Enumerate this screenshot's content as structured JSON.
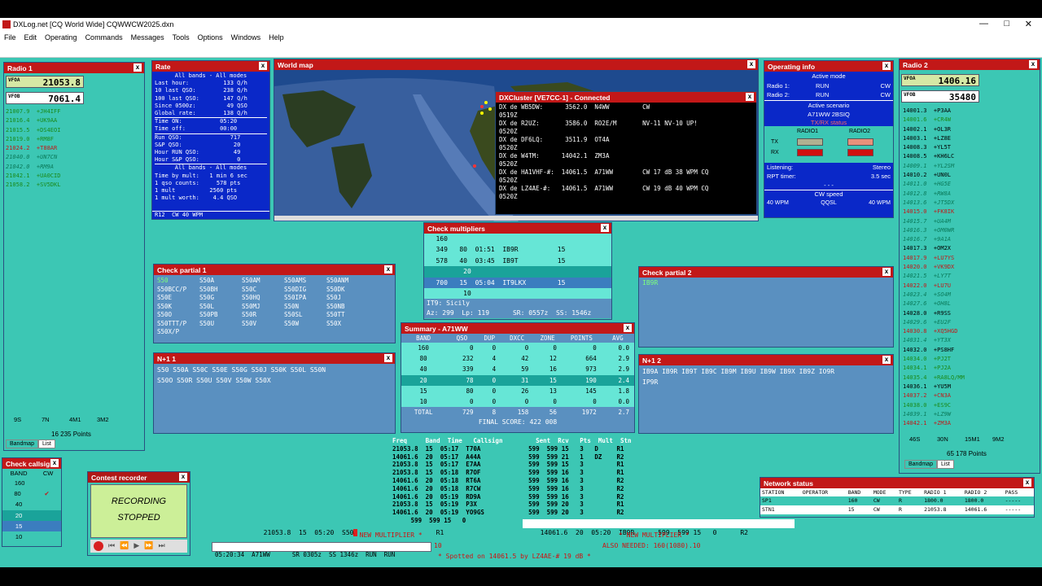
{
  "app": {
    "title": "DXLog.net [CQ World Wide] CQWWCW2025.dxn",
    "menu": [
      "File",
      "Edit",
      "Operating",
      "Commands",
      "Messages",
      "Tools",
      "Options",
      "Windows",
      "Help"
    ]
  },
  "radio1": {
    "title": "Radio 1",
    "vfoa_label": "VFOA",
    "vfoa": "21053.8",
    "vfob_label": "VFOB",
    "vfob": "7061.4",
    "spots": [
      {
        "f": "21007.9",
        "c": "+JH4IFF",
        "s": "g"
      },
      {
        "f": "21016.4",
        "c": "+UK9AA",
        "s": "g"
      },
      {
        "f": "21015.5",
        "c": "+DS4EOI",
        "s": "g"
      },
      {
        "f": "21019.0",
        "c": "+RM8F",
        "s": "g"
      },
      {
        "f": "21024.2",
        "c": "+T88AR",
        "s": "r"
      },
      {
        "f": "21040.0",
        "c": "+UN7CN",
        "s": "i"
      },
      {
        "f": "21042.0",
        "c": "+RM9A",
        "s": "i"
      },
      {
        "f": "21042.1",
        "c": "+UA0CID",
        "s": "g"
      },
      {
        "f": "21058.2",
        "c": "+SV5DKL",
        "s": "g"
      }
    ],
    "bands": [
      "9S",
      "7N",
      "4M1",
      "3M2"
    ],
    "points": "16 235 Points",
    "tabs": [
      "Bandmap",
      "List"
    ]
  },
  "rate": {
    "title": "Rate",
    "lines": [
      "All bands - All modes",
      "Last hour:          133 Q/h",
      "10 last QSO:        238 Q/h",
      "100 last QSO:       147 Q/h",
      "Since 0500z:         49 QSO",
      "Global rate:        138 Q/h",
      "Time ON:           05:20",
      "Time off:          00:00",
      "Run QSO:              717",
      "S&P QSO:               20",
      "Hour RUN QSO:          49",
      "Hour S&P QSO:           0",
      "All bands - All modes",
      "Time by mult:   1 min 6 sec",
      "1 qso counts:     578 pts",
      "1 mult          2560 pts",
      "1 mult worth:    4.4 QSO"
    ],
    "footer": "R12  CW 40 WPM"
  },
  "worldmap": {
    "title": "World map"
  },
  "dxcluster": {
    "title": "DXCluster [VE7CC-1] - Connected",
    "lines": [
      "DX de WB5DW:      3562.0  N4WW         CW",
      "0519Z",
      "DX de R2UZ:       3586.0  RO2E/M       NV-11 NV-10 UP!",
      "0520Z",
      "DX de DF6LQ:      3511.9  OT4A",
      "0520Z",
      "DX de W4TM:      14042.1  ZM3A",
      "0520Z",
      "DX de HA1VHF-#:  14061.5  A71WW        CW 17 dB 38 WPM CQ",
      "0520Z",
      "DX de LZ4AE-#:   14061.5  A71WW        CW 19 dB 40 WPM CQ",
      "0520Z"
    ]
  },
  "opinfo": {
    "title": "Operating info",
    "active_mode": "Active mode",
    "r1": "Radio 1:",
    "r1m": "RUN",
    "r1c": "CW",
    "r2": "Radio 2:",
    "r2m": "RUN",
    "r2c": "CW",
    "scenario": "Active scenario",
    "scenario_val": "A71WW 2BSIQ",
    "txrx": "TX/RX status",
    "radio1": "RADIO1",
    "radio2": "RADIO2",
    "tx": "TX",
    "rx": "RX",
    "listening": "Listening:",
    "listening_val": "Stereo",
    "rpt": "RPT timer:",
    "rpt_val": "3.5 sec",
    "dash": "- - -",
    "cwspeed": "CW speed",
    "wpm1": "40 WPM",
    "qsk": "QQSL",
    "wpm2": "40 WPM"
  },
  "radio2": {
    "title": "Radio 2",
    "vfoa_label": "VFOA",
    "vfoa": "1406.16",
    "vfob_label": "VFOB",
    "vfob": "35480",
    "spots": [
      {
        "f": "14001.3",
        "c": "+P3AA",
        "s": "w"
      },
      {
        "f": "14001.6",
        "c": "+CR4W",
        "s": "g"
      },
      {
        "f": "14002.1",
        "c": "+OL3R",
        "s": "w"
      },
      {
        "f": "14003.1",
        "c": "+LZ8E",
        "s": "w"
      },
      {
        "f": "14008.3",
        "c": "+YL5T",
        "s": "w"
      },
      {
        "f": "14008.5",
        "c": "+KH6LC",
        "s": "w"
      },
      {
        "f": "14009.1",
        "c": "+YL2SM",
        "s": "i"
      },
      {
        "f": "14010.2",
        "c": "+UN0L",
        "s": "w"
      },
      {
        "f": "14011.0",
        "c": "+HG5E",
        "s": "i"
      },
      {
        "f": "14012.8",
        "c": "+RW8A",
        "s": "i"
      },
      {
        "f": "14013.6",
        "c": "+JT5DX",
        "s": "i"
      },
      {
        "f": "14015.0",
        "c": "+FK8IK",
        "s": "r"
      },
      {
        "f": "14015.7",
        "c": "+UA4M",
        "s": "i"
      },
      {
        "f": "14016.3",
        "c": "+OM0WR",
        "s": "i"
      },
      {
        "f": "14016.7",
        "c": "+9A1A",
        "s": "i"
      },
      {
        "f": "14017.3",
        "c": "+OM2X",
        "s": "w"
      },
      {
        "f": "14017.9",
        "c": "+LU7YS",
        "s": "r"
      },
      {
        "f": "14020.0",
        "c": "+VK9DX",
        "s": "r"
      },
      {
        "f": "14021.5",
        "c": "+LY7T",
        "s": "i"
      },
      {
        "f": "14022.0",
        "c": "+LU7U",
        "s": "r"
      },
      {
        "f": "14023.4",
        "c": "+SO4M",
        "s": "i"
      },
      {
        "f": "14027.6",
        "c": "+OH8L",
        "s": "i"
      },
      {
        "f": "14028.0",
        "c": "+R9SS",
        "s": "w"
      },
      {
        "f": "14029.6",
        "c": "+EU2F",
        "s": "i"
      },
      {
        "f": "14030.8",
        "c": "+XQ5HGD",
        "s": "r"
      },
      {
        "f": "14031.4",
        "c": "+YT3X",
        "s": "i"
      },
      {
        "f": "14032.0",
        "c": "+PS8HF",
        "s": "w"
      },
      {
        "f": "14034.0",
        "c": "+PJ2T",
        "s": "g"
      },
      {
        "f": "14034.1",
        "c": "+PJ2A",
        "s": "g"
      },
      {
        "f": "14035.4",
        "c": "+RA8LQ/MM",
        "s": "g"
      },
      {
        "f": "14036.1",
        "c": "+YU5M",
        "s": "w"
      },
      {
        "f": "14037.2",
        "c": "+CN3A",
        "s": "r"
      },
      {
        "f": "14038.0",
        "c": "+ES9C",
        "s": "g"
      },
      {
        "f": "14039.1",
        "c": "+LZ9W",
        "s": "i"
      },
      {
        "f": "14042.1",
        "c": "+ZM3A",
        "s": "r"
      }
    ],
    "bands": [
      "46S",
      "30N",
      "15M1",
      "9M2"
    ],
    "points": "65 178 Points",
    "tabs": [
      "Bandmap",
      "List"
    ]
  },
  "checkmult": {
    "title": "Check multipliers",
    "rows": [
      {
        "t": "   160",
        "cls": "cyanrow"
      },
      {
        "t": "   349   80  01:51  IB9R          15",
        "cls": "cyanrow"
      },
      {
        "t": "   578   40  03:45  IB9T          15",
        "cls": "cyanrow"
      },
      {
        "t": "          20",
        "cls": "tealrow"
      },
      {
        "t": "   700   15  05:04  IT9LKX        15",
        "cls": "sel"
      },
      {
        "t": "          10",
        "cls": "cyanrow"
      }
    ],
    "info1": "IT9: Sicily",
    "info2": "Az: 299  Lp: 119      SR: 0557z  SS: 1546z"
  },
  "partial1": {
    "title": "Check partial 1",
    "rows": [
      [
        "S50",
        "S50A",
        "S50AM",
        "S50AMS",
        "S50ANM"
      ],
      [
        "S50BCC/P",
        "S50BH",
        "S50C",
        "S50DIG",
        "S50DK"
      ],
      [
        "S50E",
        "S50G",
        "S50HQ",
        "S50IPA",
        "S50J"
      ],
      [
        "S50K",
        "S50L",
        "S50MJ",
        "S50N",
        "S50NB"
      ],
      [
        "S50O",
        "S50PB",
        "S50R",
        "S50SL",
        "S50TT"
      ],
      [
        "S50TTT/P",
        "S50U",
        "S50V",
        "S50W",
        "S50X"
      ],
      [
        "S50X/P",
        "",
        "",
        "",
        ""
      ]
    ]
  },
  "partial2": {
    "title": "Check partial 2",
    "val": "IB9R"
  },
  "n1": {
    "title": "N+1 1",
    "line1": "S50 S50A S50C S50E S50G S50J S50K S50L S50N",
    "line2": "S50O S50R S50U S50V S50W S50X"
  },
  "n2": {
    "title": "N+1 2",
    "line1": "IB9A IB9R IB9T IB9C IB9M IB9U IB9W IB9X IB9Z IO9R",
    "line2": "IP9R"
  },
  "summary": {
    "title": "Summary - A71WW",
    "headers": [
      "BAND",
      "QSO",
      "DUP",
      "DXCC",
      "ZONE",
      "POINTS",
      "AVG"
    ],
    "rows": [
      [
        "160",
        "0",
        "0",
        "0",
        "0",
        "0",
        "0.0"
      ],
      [
        "80",
        "232",
        "4",
        "42",
        "12",
        "664",
        "2.9"
      ],
      [
        "40",
        "339",
        "4",
        "59",
        "16",
        "973",
        "2.9"
      ],
      [
        "20",
        "78",
        "0",
        "31",
        "15",
        "190",
        "2.4"
      ],
      [
        "15",
        "80",
        "0",
        "26",
        "13",
        "145",
        "1.8"
      ],
      [
        "10",
        "0",
        "0",
        "0",
        "0",
        "0",
        "0.0"
      ],
      [
        "TOTAL",
        "729",
        "8",
        "158",
        "56",
        "1972",
        "2.7"
      ]
    ],
    "score": "FINAL SCORE: 422 008"
  },
  "log": {
    "header": "Freq     Band  Time   Callsign         Sent  Rcv   Pts  Mult  Stn",
    "rows": [
      "21053.8  15  05:17  T70A             599  599 15   3   D     R1",
      "14061.6  20  05:17  A44A             599  599 21   1   DZ    R2",
      "21053.8  15  05:17  E7AA             599  599 15   3         R1",
      "21053.8  15  05:18  R7OF             599  599 16   3         R1",
      "14061.6  20  05:18  RT6A             599  599 16   3         R2",
      "14061.6  20  05:18  R7CW             599  599 16   3         R2",
      "14061.6  20  05:19  RD9A             599  599 16   3         R2",
      "21053.8  15  05:19  P3X              599  599 20   3         R1",
      "14061.6  20  05:19  YO9GS            599  599 20   3         R2",
      "     599  599 15   0"
    ]
  },
  "entry1": {
    "freq": "21053.8",
    "band": "15",
    "time": "05:20",
    "call": "S50",
    "rst": "R1"
  },
  "entry2": {
    "freq": "14061.6",
    "band": "20",
    "time": "05:20",
    "call": "IB9R",
    "rst": "599  599 15   0",
    "stn": "R2"
  },
  "status": {
    "newmult1": "* NEW MULTIPLIER *",
    "newmult2": "* NEW MULTIPLIER *",
    "time": "05:20:34",
    "call": "A71WW",
    "sr": "SR 0305z",
    "ss": "SS 1346z",
    "run1": "RUN",
    "run2": "RUN",
    "ten": "10",
    "also": "ALSO NEEDED: 160(1080).10",
    "spotted": "* Spotted on 14061.5 by LZ4AE-# 19 dB *"
  },
  "checkcall": {
    "title": "Check callsign",
    "h1": "BAND",
    "h2": "CW",
    "bands": [
      "160",
      "80",
      "40",
      "20",
      "15",
      "10"
    ]
  },
  "recorder": {
    "title": "Contest recorder",
    "l1": "RECORDING",
    "l2": "STOPPED"
  },
  "network": {
    "title": "Network status",
    "headers": [
      "STATION",
      "OPERATOR",
      "BAND",
      "MODE",
      "TYPE",
      "RADIO 1",
      "RADIO 2",
      "PASS"
    ],
    "rows": [
      [
        "SP1",
        "",
        "160",
        "CW",
        "R",
        "1800.0",
        "1800.0",
        "-----"
      ],
      [
        "STN1",
        "",
        "15",
        "CW",
        "R",
        "21053.8",
        "14061.6",
        "-----"
      ]
    ]
  }
}
